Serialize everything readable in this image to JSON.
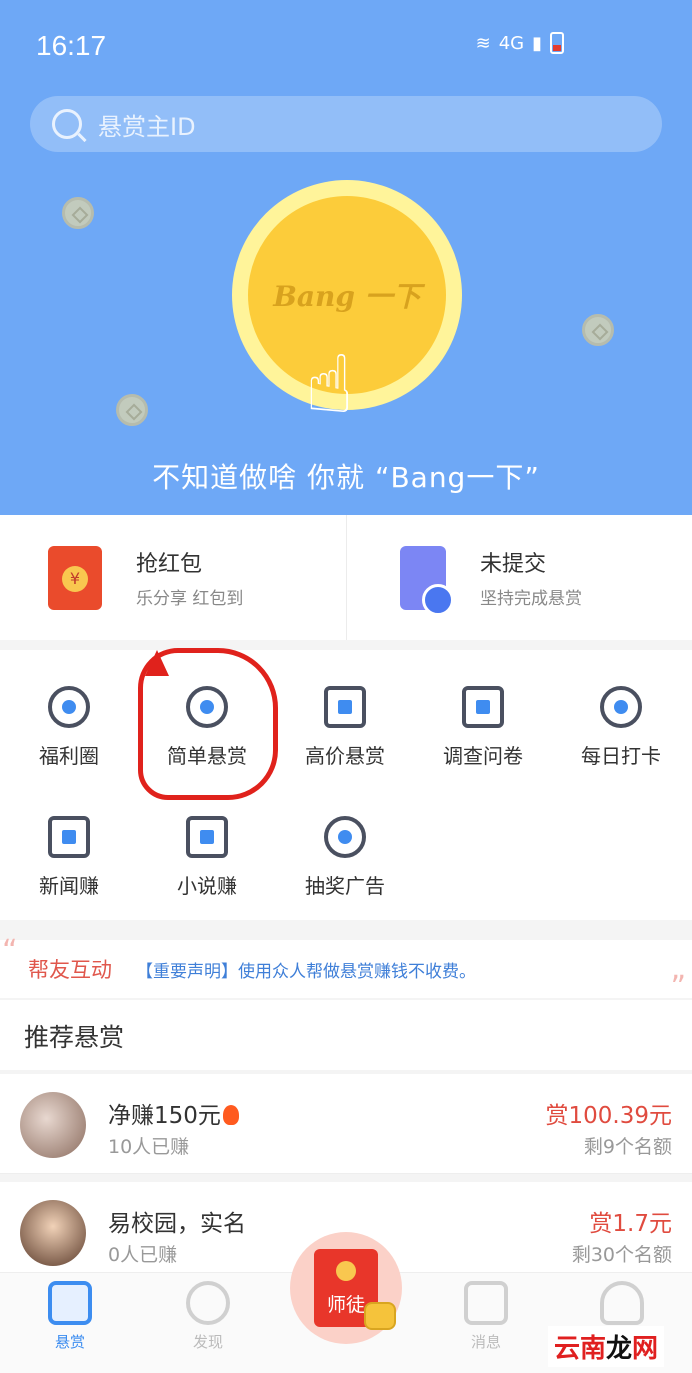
{
  "status": {
    "time": "16:17",
    "network": "4G"
  },
  "search": {
    "placeholder": "悬赏主ID"
  },
  "hero": {
    "coin_text": "Bang 一下",
    "slogan": "不知道做啥 你就 “Bang一下”"
  },
  "quick_cards": [
    {
      "title": "抢红包",
      "subtitle": "乐分享 红包到",
      "icon": "red-envelope-icon"
    },
    {
      "title": "未提交",
      "subtitle": "坚持完成悬赏",
      "icon": "document-clock-icon"
    }
  ],
  "grid": [
    {
      "label": "福利圈",
      "icon": "welfare-circle-icon"
    },
    {
      "label": "简单悬赏",
      "icon": "simple-reward-icon"
    },
    {
      "label": "高价悬赏",
      "icon": "wallet-icon"
    },
    {
      "label": "调查问卷",
      "icon": "survey-icon"
    },
    {
      "label": "每日打卡",
      "icon": "alarm-clock-icon"
    },
    {
      "label": "新闻赚",
      "icon": "news-icon"
    },
    {
      "label": "小说赚",
      "icon": "book-icon"
    },
    {
      "label": "抽奖广告",
      "icon": "lottery-icon"
    }
  ],
  "notice": {
    "title": "帮友互动",
    "text": "【重要声明】使用众人帮做悬赏赚钱不收费。"
  },
  "recommended": {
    "header": "推荐悬赏",
    "items": [
      {
        "title": "净赚150元",
        "earned": "10人已赚",
        "reward": "赏100.39元",
        "remaining": "剩9个名额"
      },
      {
        "title": "易校园，实名",
        "earned": "0人已赚",
        "reward": "赏1.7元",
        "remaining": "剩30个名额"
      }
    ]
  },
  "tabbar": {
    "items": [
      {
        "label": "悬赏",
        "active": true
      },
      {
        "label": "发现"
      },
      {
        "label": "师徒"
      },
      {
        "label": "消息"
      },
      {
        "label": ""
      }
    ]
  },
  "watermark": {
    "text_red": "云南",
    "text_black": "龙",
    "text_red2": "网"
  },
  "colors": {
    "hero_bg": "#6ea8f6",
    "accent_blue": "#3d8df0",
    "reward_red": "#e04b3f",
    "annotation_red": "#e0221c"
  }
}
